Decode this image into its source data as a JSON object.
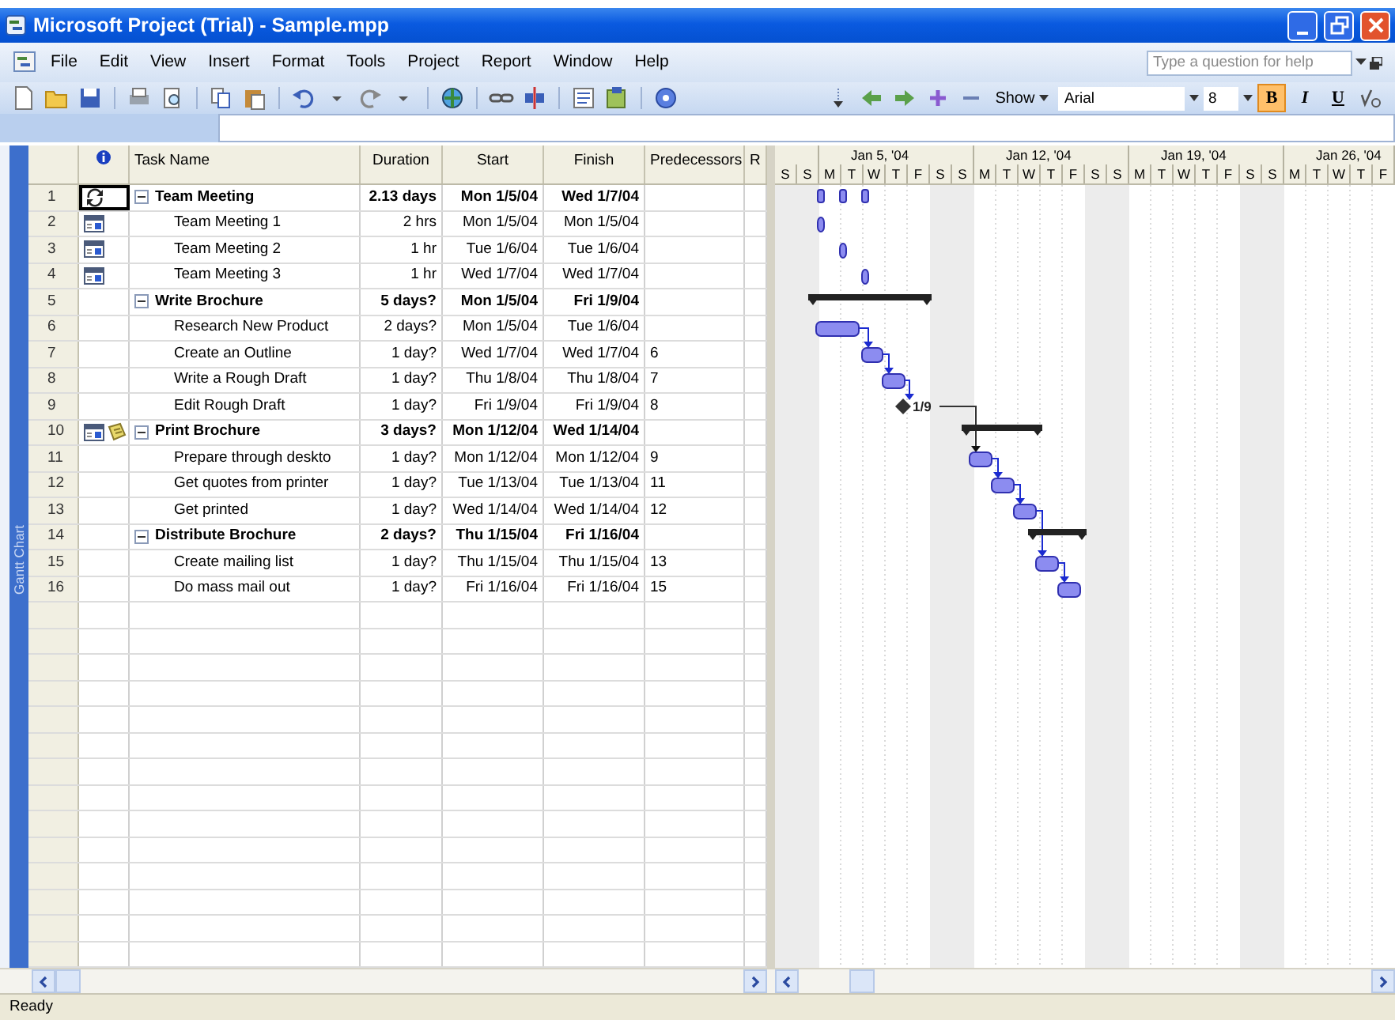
{
  "window": {
    "title": "Microsoft Project (Trial) - Sample.mpp"
  },
  "menu_bar": {
    "items": [
      "File",
      "Edit",
      "View",
      "Insert",
      "Format",
      "Tools",
      "Project",
      "Report",
      "Window",
      "Help"
    ],
    "help_field": {
      "placeholder": "Type a question for help"
    }
  },
  "formatting_toolbar": {
    "show_menu": "Show",
    "font": "Arial",
    "font_size": "8",
    "style_buttons": [
      {
        "label": "B",
        "selected": true
      },
      {
        "label": "I",
        "selected": false
      },
      {
        "label": "U",
        "selected": false
      }
    ]
  },
  "view_bar": {
    "label": "Gantt Chart"
  },
  "table": {
    "columns": [
      "Task Name",
      "Duration",
      "Start",
      "Finish",
      "Predecessors",
      "R"
    ],
    "rows": [
      {
        "id": "1",
        "kind": "recurring",
        "selected": true,
        "expanded": true,
        "indicators": [
          {
            "kind": "recurring"
          }
        ],
        "name": "Team Meeting",
        "duration": "2.13 days",
        "start": "Mon 1/5/04",
        "finish": "Wed 1/7/04",
        "children": [
          {
            "id": "2",
            "kind": "task",
            "selected": false,
            "indicators": [
              {
                "kind": "calendar"
              }
            ],
            "name": "Team Meeting 1",
            "duration": "2 hrs",
            "start": "Mon 1/5/04",
            "finish": "Mon 1/5/04"
          },
          {
            "id": "3",
            "kind": "task",
            "selected": false,
            "indicators": [
              {
                "kind": "calendar"
              }
            ],
            "name": "Team Meeting 2",
            "duration": "1 hr",
            "start": "Tue 1/6/04",
            "finish": "Tue 1/6/04"
          },
          {
            "id": "4",
            "kind": "task",
            "selected": false,
            "indicators": [
              {
                "kind": "calendar"
              }
            ],
            "name": "Team Meeting 3",
            "duration": "1 hr",
            "start": "Wed 1/7/04",
            "finish": "Wed 1/7/04"
          }
        ]
      },
      {
        "id": "5",
        "kind": "summary",
        "selected": false,
        "expanded": true,
        "name": "Write Brochure",
        "duration": "5 days?",
        "start": "Mon 1/5/04",
        "finish": "Fri 1/9/04",
        "children": [
          {
            "id": "6",
            "kind": "task",
            "selected": false,
            "name": "Research New Product",
            "duration": "2 days?",
            "start": "Mon 1/5/04",
            "finish": "Tue 1/6/04"
          },
          {
            "id": "7",
            "kind": "task",
            "selected": false,
            "name": "Create an Outline",
            "duration": "1 day?",
            "start": "Wed 1/7/04",
            "finish": "Wed 1/7/04",
            "predecessors": "6"
          },
          {
            "id": "8",
            "kind": "task",
            "selected": false,
            "name": "Write a Rough Draft",
            "duration": "1 day?",
            "start": "Thu 1/8/04",
            "finish": "Thu 1/8/04",
            "predecessors": "7"
          },
          {
            "id": "9",
            "kind": "milestone",
            "selected": false,
            "name": "Edit Rough Draft",
            "duration": "1 day?",
            "start": "Fri 1/9/04",
            "finish": "Fri 1/9/04",
            "predecessors": "8",
            "bar_label": "1/9"
          }
        ]
      },
      {
        "id": "10",
        "kind": "summary",
        "selected": false,
        "expanded": true,
        "indicators": [
          {
            "kind": "calendar"
          },
          {
            "kind": "note"
          }
        ],
        "name": "Print Brochure",
        "duration": "3 days?",
        "start": "Mon 1/12/04",
        "finish": "Wed 1/14/04",
        "children": [
          {
            "id": "11",
            "kind": "task",
            "selected": false,
            "name": "Prepare through deskto",
            "duration": "1 day?",
            "start": "Mon 1/12/04",
            "finish": "Mon 1/12/04",
            "predecessors": "9"
          },
          {
            "id": "12",
            "kind": "task",
            "selected": false,
            "name": "Get quotes from printer",
            "duration": "1 day?",
            "start": "Tue 1/13/04",
            "finish": "Tue 1/13/04",
            "predecessors": "11"
          },
          {
            "id": "13",
            "kind": "task",
            "selected": false,
            "name": "Get printed",
            "duration": "1 day?",
            "start": "Wed 1/14/04",
            "finish": "Wed 1/14/04",
            "predecessors": "12"
          }
        ]
      },
      {
        "id": "14",
        "kind": "summary",
        "selected": false,
        "expanded": true,
        "name": "Distribute Brochure",
        "duration": "2 days?",
        "start": "Thu 1/15/04",
        "finish": "Fri 1/16/04",
        "children": [
          {
            "id": "15",
            "kind": "task",
            "selected": false,
            "name": "Create mailing list",
            "duration": "1 day?",
            "start": "Thu 1/15/04",
            "finish": "Thu 1/15/04",
            "predecessors": "13"
          },
          {
            "id": "16",
            "kind": "task",
            "selected": false,
            "name": "Do mass mail out",
            "duration": "1 day?",
            "start": "Fri 1/16/04",
            "finish": "Fri 1/16/04",
            "predecessors": "15"
          }
        ]
      }
    ]
  },
  "gantt": {
    "weeks": [
      "Jan 5, '04",
      "Jan 12, '04",
      "Jan 19, '04",
      "Jan 26, '04"
    ],
    "days": [
      "S",
      "S",
      "M",
      "T",
      "W",
      "T",
      "F",
      "S",
      "S",
      "M",
      "T",
      "W",
      "T",
      "F",
      "S",
      "S",
      "M",
      "T",
      "W",
      "T",
      "F",
      "S",
      "S",
      "M",
      "T",
      "W",
      "T",
      "F"
    ]
  },
  "status_bar": {
    "text": "Ready"
  }
}
